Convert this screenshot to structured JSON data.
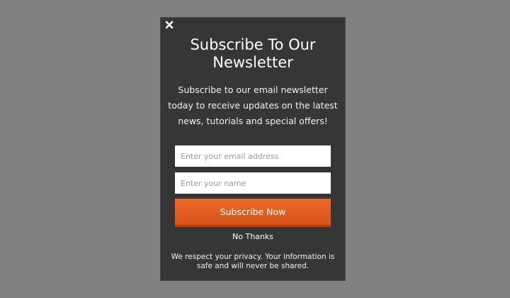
{
  "popup": {
    "close_icon": "close-icon",
    "title": "Subscribe To Our Newsletter",
    "description": "Subscribe to our email newsletter today to receive updates on the latest news, tutorials and special offers!",
    "email_placeholder": "Enter your email address",
    "name_placeholder": "Enter your name",
    "subscribe_label": "Subscribe Now",
    "no_thanks_label": "No Thanks",
    "privacy_text": "We respect your privacy. Your information is safe and will never be shared."
  },
  "colors": {
    "overlay": "#818181",
    "modal_background": "#363636",
    "button_accent": "#e45f22",
    "text": "#ffffff"
  }
}
